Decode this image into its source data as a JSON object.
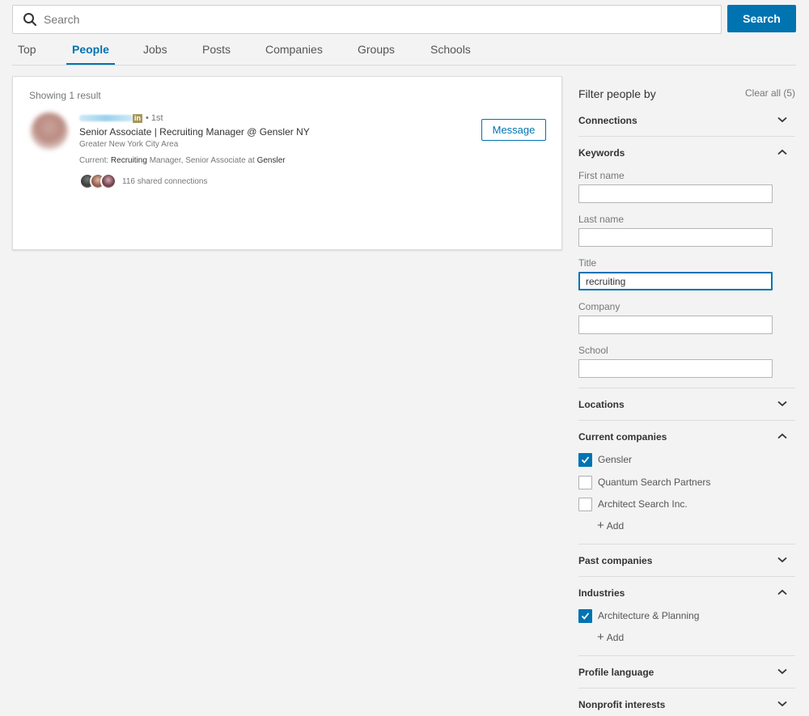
{
  "search": {
    "placeholder": "Search",
    "button_label": "Search"
  },
  "tabs": [
    {
      "label": "Top"
    },
    {
      "label": "People"
    },
    {
      "label": "Jobs"
    },
    {
      "label": "Posts"
    },
    {
      "label": "Companies"
    },
    {
      "label": "Groups"
    },
    {
      "label": "Schools"
    }
  ],
  "results": {
    "count_text": "Showing 1 result",
    "items": [
      {
        "badge": "in",
        "degree": "• 1st",
        "headline": "Senior Associate | Recruiting Manager @ Gensler NY",
        "location": "Greater New York City Area",
        "current_prefix": "Current:",
        "current_keyword": "Recruiting",
        "current_middle": "Manager, Senior Associate at",
        "current_company": "Gensler",
        "shared_connections": "116 shared connections",
        "message_label": "Message"
      }
    ]
  },
  "filters": {
    "title": "Filter people by",
    "clear_all": "Clear all (5)",
    "connections": "Connections",
    "keywords": {
      "title": "Keywords",
      "first_name_label": "First name",
      "first_name_value": "",
      "last_name_label": "Last name",
      "last_name_value": "",
      "title_label": "Title",
      "title_value": "recruiting",
      "company_label": "Company",
      "company_value": "",
      "school_label": "School",
      "school_value": ""
    },
    "locations": "Locations",
    "current_companies": {
      "title": "Current companies",
      "options": [
        {
          "label": "Gensler",
          "checked": true
        },
        {
          "label": "Quantum Search Partners",
          "checked": false
        },
        {
          "label": "Architect Search Inc.",
          "checked": false
        }
      ],
      "add_label": "Add"
    },
    "past_companies": "Past companies",
    "industries": {
      "title": "Industries",
      "options": [
        {
          "label": "Architecture & Planning",
          "checked": true
        }
      ],
      "add_label": "Add"
    },
    "profile_language": "Profile language",
    "nonprofit_interests": "Nonprofit interests"
  },
  "colors": {
    "accent": "#0073b1",
    "badge": "#a89659",
    "background": "#f3f3f3"
  },
  "icons": {
    "search": "search-icon",
    "chevron_down": "chevron-down-icon",
    "chevron_up": "chevron-up-icon",
    "check": "check-icon",
    "plus": "plus-icon"
  }
}
